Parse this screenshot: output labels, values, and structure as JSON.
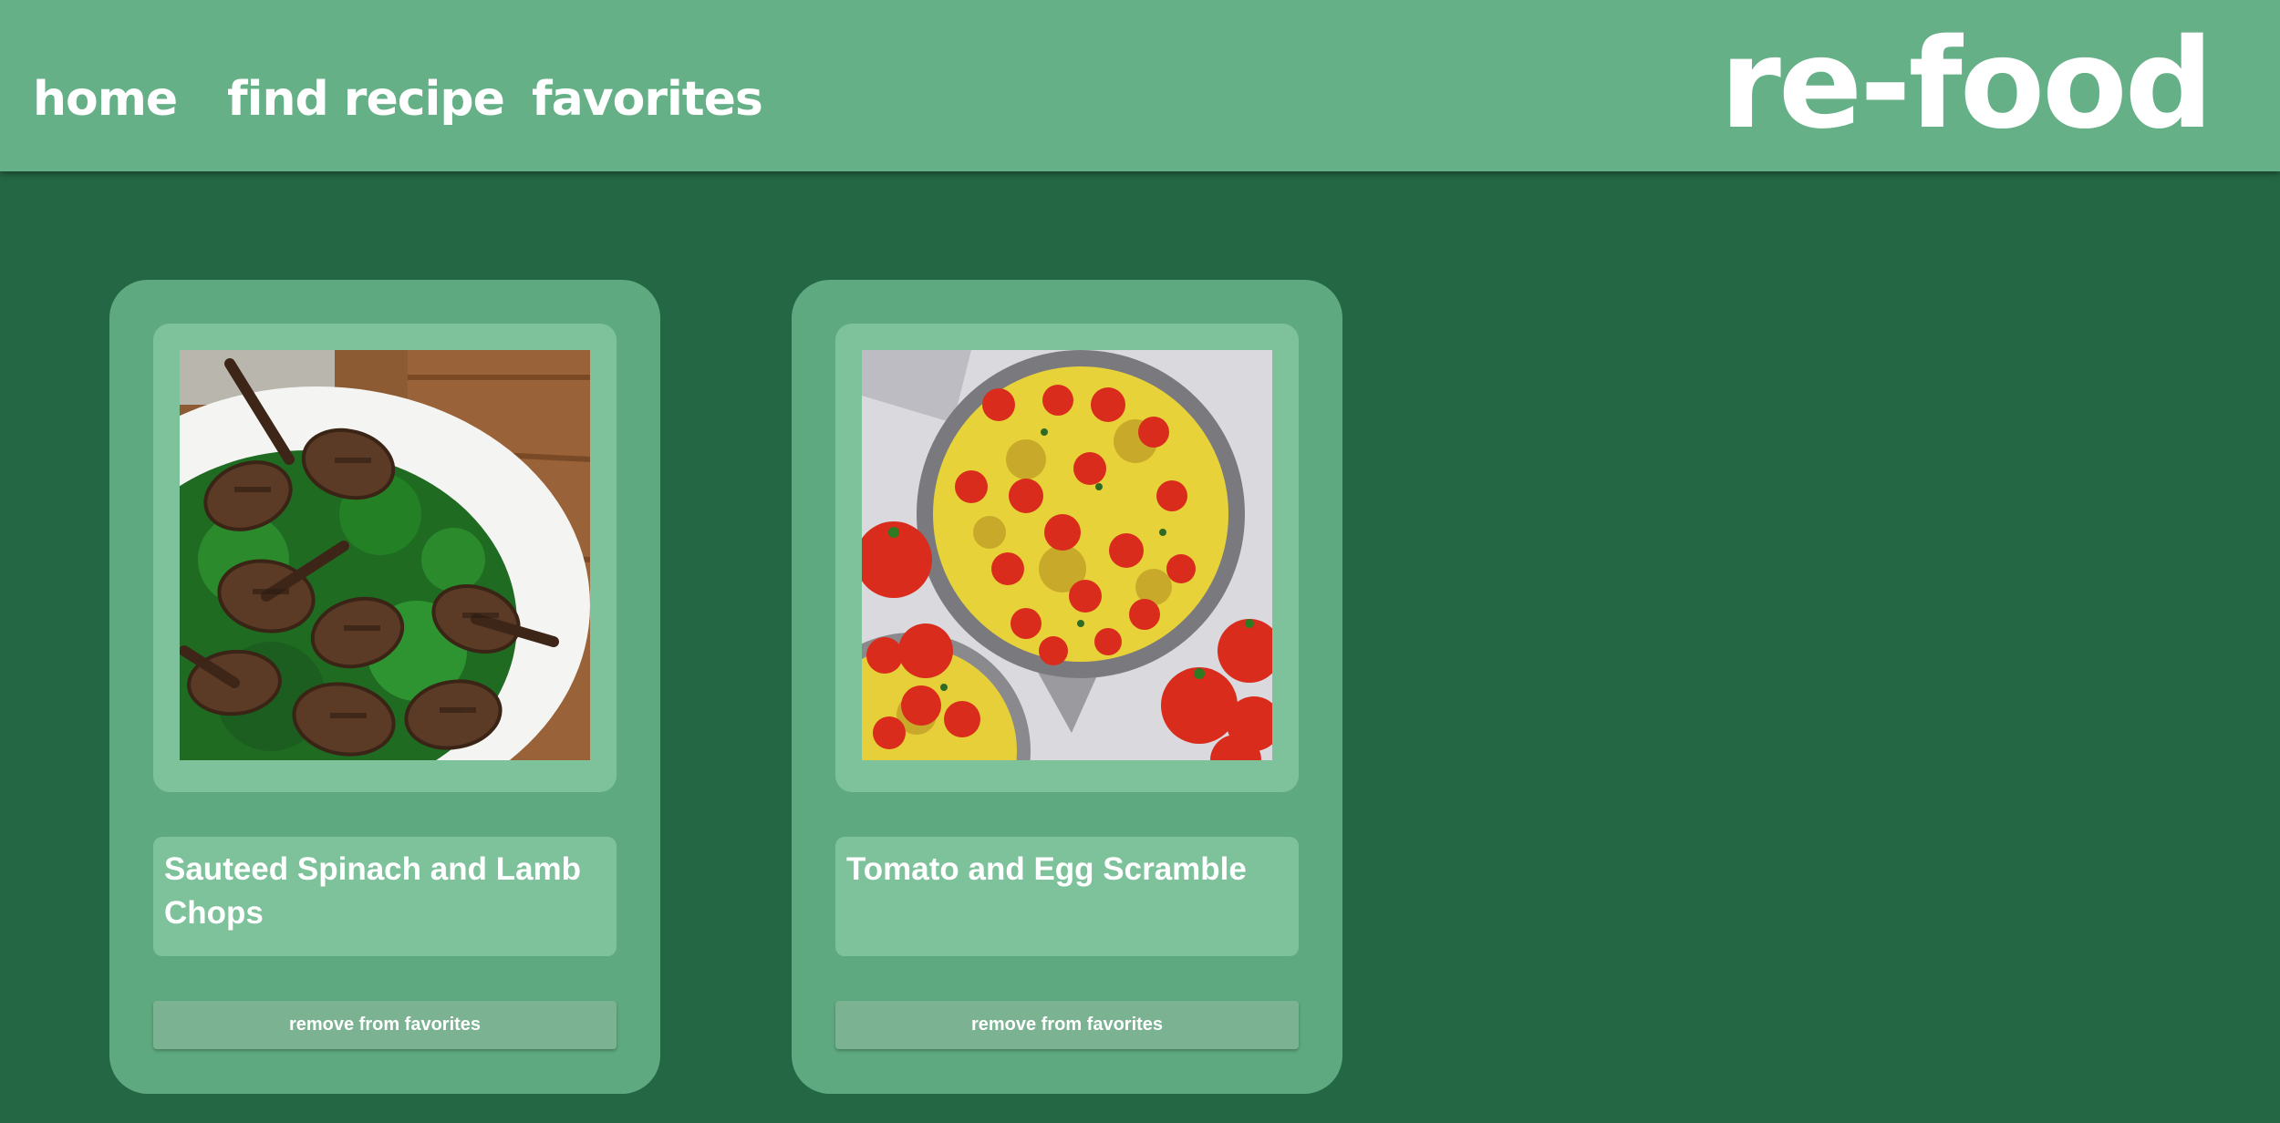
{
  "app": {
    "logo": "re-food"
  },
  "nav": {
    "home": "home",
    "find_recipe": "find recipe",
    "favorites": "favorites"
  },
  "favorites": {
    "cards": [
      {
        "title": "Sauteed Spinach and Lamb Chops",
        "image": "lamb-chops-spinach-photo",
        "button_label": "remove from favorites"
      },
      {
        "title": "Tomato and Egg Scramble",
        "image": "tomato-egg-scramble-photo",
        "button_label": "remove from favorites"
      }
    ]
  },
  "colors": {
    "page_background": "#246745",
    "header": "#65b087",
    "card": "#5ea97f",
    "panel": "#7ec29b",
    "button": "#7bb392",
    "text": "#ffffff"
  }
}
